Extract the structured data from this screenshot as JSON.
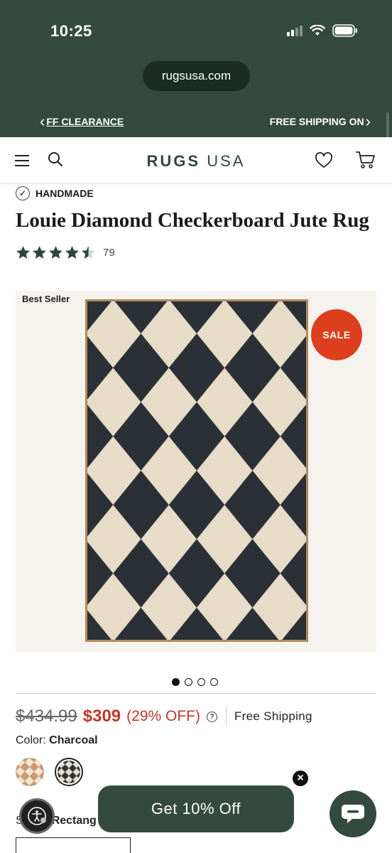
{
  "status_bar": {
    "time": "10:25"
  },
  "browser": {
    "url": "rugsusa.com"
  },
  "promo": {
    "left_text": "FF CLEARANCE",
    "right_text": "FREE SHIPPING ON"
  },
  "header": {
    "logo_bold": "RUGS",
    "logo_light": "USA"
  },
  "product": {
    "badge": "HANDMADE",
    "title": "Louie Diamond Checkerboard Jute Rug",
    "rating": 4.5,
    "review_count": "79",
    "best_seller": "Best Seller",
    "sale_badge": "SALE",
    "gallery_dots": 4,
    "gallery_active_index": 0,
    "original_price": "$434.99",
    "sale_price": "$309",
    "discount": "(29% OFF)",
    "help_icon": "?",
    "shipping": "Free Shipping",
    "color_label": "Color:",
    "color_value": "Charcoal",
    "colors": [
      "Natural",
      "Charcoal"
    ],
    "size_label": "S",
    "size_value": "Rectang"
  },
  "floating": {
    "offer_button": "Get 10% Off",
    "close": "×"
  },
  "colors": {
    "brand_green": "#344a3f",
    "sale_red": "#dc3f1e",
    "price_red": "#c0392b",
    "rug_dark": "#2b3036",
    "rug_light": "#e6dcc7"
  }
}
